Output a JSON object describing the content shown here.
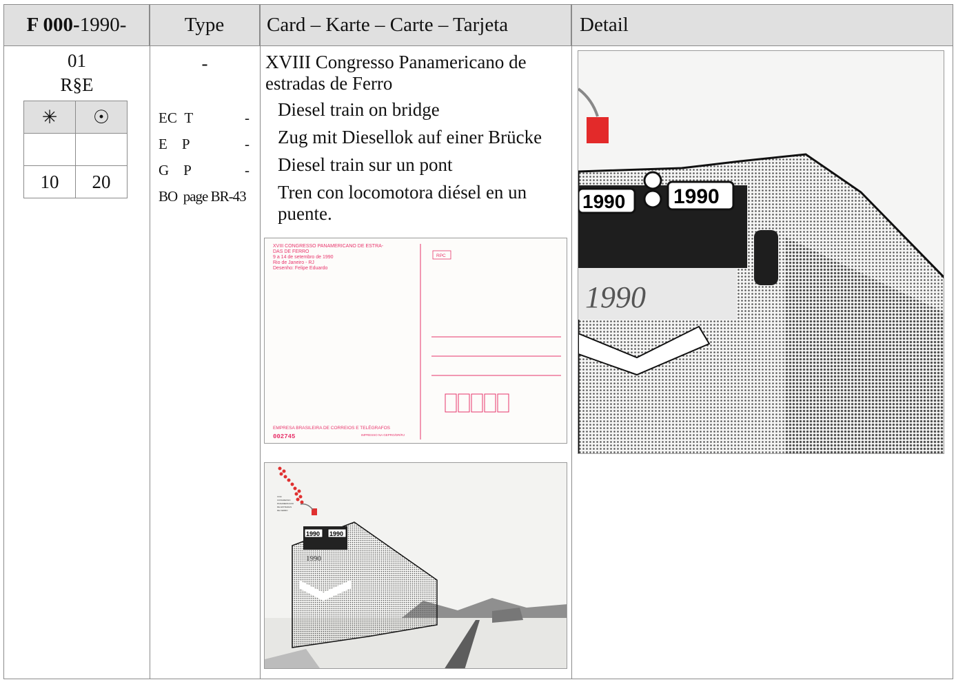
{
  "header": {
    "number_prefix": "F 000-",
    "number_suffix": "1990-",
    "type": "Type",
    "card": "Card – Karte – Carte – Tarjeta",
    "detail": "Detail"
  },
  "entry": {
    "number": "01",
    "code": "R§E",
    "price": {
      "mint_symbol": "✳",
      "used_symbol": "☉",
      "mint": "10",
      "used": "20"
    },
    "type_dash": "-",
    "type_rows": [
      {
        "code": "EC",
        "val": "T",
        "dash": "-"
      },
      {
        "code": "E",
        "val": "P",
        "dash": "-"
      },
      {
        "code": "G",
        "val": "P",
        "dash": "-"
      },
      {
        "code": "BO",
        "val": "page BR-43",
        "dash": ""
      }
    ],
    "title": "XVIII Congresso Panamericano de estradas de Ferro",
    "descriptions": [
      "Diesel train on bridge",
      "Zug mit Diesellok auf einer Brücke",
      "Diesel train sur un pont",
      "Tren con locomotora diésel en un puente."
    ]
  },
  "card_back": {
    "event_text": [
      "XVIII CONGRESSO PANAMERICANO DE ESTRA-",
      "DAS DE FERRO",
      "9 a 14 de setembro de 1990",
      "Rio de Janeiro - RJ",
      "Desenho: Felipe Eduardo"
    ],
    "rpc": "RPC",
    "company": "EMPRESA BRASILEIRA DE CORREIOS E TELÉGRAFOS",
    "serial": "002745",
    "printer": "IMPRESSO NA GEPRO/DR/RJ",
    "accent_color": "#e8336b"
  },
  "locomotive": {
    "plate_left": "1990",
    "plate_right": "1990",
    "nose": "1990"
  }
}
